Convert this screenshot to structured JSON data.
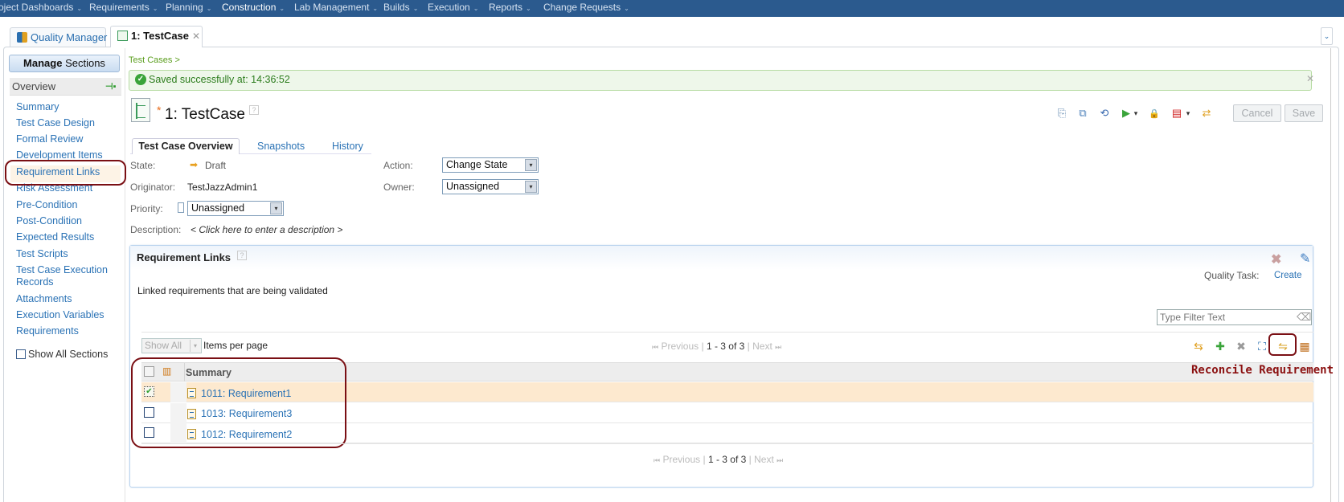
{
  "topnav": {
    "items": [
      {
        "label": "oject Dashboards"
      },
      {
        "label": "Requirements"
      },
      {
        "label": "Planning"
      },
      {
        "label": "Construction"
      },
      {
        "label": "Lab Management"
      },
      {
        "label": "Builds"
      },
      {
        "label": "Execution"
      },
      {
        "label": "Reports"
      },
      {
        "label": "Change Requests"
      }
    ],
    "active": "Construction",
    "chevron": "⌄"
  },
  "tabs": {
    "items": [
      {
        "label": "Quality Manager"
      },
      {
        "label": "1: TestCase",
        "close": "✕"
      }
    ],
    "dropdown": "⌄"
  },
  "sidebar": {
    "manage_bold": "Manage",
    "manage_rest": " Sections",
    "overview": "Overview",
    "pin": "⊣▪",
    "items": [
      {
        "label": "Summary"
      },
      {
        "label": "Test Case Design"
      },
      {
        "label": "Formal Review"
      },
      {
        "label": "Development Items"
      },
      {
        "label": "Requirement Links"
      },
      {
        "label": "Risk Assessment"
      },
      {
        "label": "Pre-Condition"
      },
      {
        "label": "Post-Condition"
      },
      {
        "label": "Expected Results"
      },
      {
        "label": "Test Scripts"
      },
      {
        "label": "Test Case Execution"
      },
      {
        "label": "Records"
      },
      {
        "label": "Attachments"
      },
      {
        "label": "Execution Variables"
      },
      {
        "label": "Requirements"
      }
    ],
    "active_item": "Requirement Links",
    "show_all_sections": "Show All Sections"
  },
  "main": {
    "breadcrumb": "Test Cases >",
    "saved_message": "Saved successfully at: 14:36:52",
    "saved_check": "✓",
    "saved_close": "✕",
    "dirty_marker": "*",
    "title": "1: TestCase",
    "help": "?",
    "toolbar_icons": [
      {
        "name": "copy-icon",
        "glyph": "⎘",
        "color": "#6a8fb5"
      },
      {
        "name": "duplicate-icon",
        "glyph": "⧉",
        "color": "#4a7fb8"
      },
      {
        "name": "sync-icon",
        "glyph": "⟲",
        "color": "#3a6ab0"
      },
      {
        "name": "run-icon",
        "glyph": "▶",
        "color": "#3aa43a"
      },
      {
        "name": "run-dropdown-icon",
        "glyph": "▾",
        "color": "#333"
      },
      {
        "name": "lock-icon",
        "glyph": "🔒",
        "color": "#d8a020"
      },
      {
        "name": "pdf-icon",
        "glyph": "▤",
        "color": "#d02020"
      },
      {
        "name": "pdf-dropdown-icon",
        "glyph": "▾",
        "color": "#333"
      },
      {
        "name": "refresh-icon",
        "glyph": "⇄",
        "color": "#e0a020"
      }
    ],
    "cancel_label": "Cancel",
    "save_label": "Save",
    "section_tabs": [
      {
        "label": "Test Case Overview"
      },
      {
        "label": "Snapshots"
      },
      {
        "label": "History"
      }
    ],
    "fields": {
      "state_label": "State:",
      "state_value": "Draft",
      "state_icon": "➡",
      "originator_label": "Originator:",
      "originator_value": "TestJazzAdmin1",
      "priority_label": "Priority:",
      "priority_value": "Unassigned",
      "description_label": "Description:",
      "description_value": "< Click here to enter a description >",
      "action_label": "Action:",
      "action_value": "Change State",
      "owner_label": "Owner:",
      "owner_value": "Unassigned",
      "select_arrow": "▾"
    }
  },
  "requirement_links": {
    "title": "Requirement Links",
    "help": "?",
    "close_glyph": "✖",
    "edit_glyph": "✎",
    "quality_task_label": "Quality Task:",
    "quality_task_create": "Create",
    "description": "Linked requirements that are being validated",
    "filter_placeholder": "Type Filter Text",
    "filter_clear_glyph": "⌫",
    "items_per_page_value": "Show All",
    "items_per_page_label": "Items per page",
    "pager": {
      "first": "⏮",
      "previous": "Previous",
      "count": "1 - 3 of 3",
      "next": "Next",
      "last": "⏭",
      "sep": "|"
    },
    "toolbar_icons": [
      {
        "name": "refresh-icon",
        "glyph": "⇆",
        "color": "#e0a020"
      },
      {
        "name": "add-icon",
        "glyph": "✚",
        "color": "#3aa43a"
      },
      {
        "name": "remove-icon",
        "glyph": "✖",
        "color": "#999"
      },
      {
        "name": "link-icon",
        "glyph": "⛶",
        "color": "#2a6fb0"
      },
      {
        "name": "reconcile-requirements-icon",
        "glyph": "⇋",
        "color": "#d8a020"
      },
      {
        "name": "column-config-icon",
        "glyph": "▦",
        "color": "#c07020"
      }
    ],
    "table": {
      "columns_icon": "▥",
      "header_summary": "Summary",
      "rows": [
        {
          "id": "1011",
          "label": "1011: Requirement1",
          "checked": true
        },
        {
          "id": "1013",
          "label": "1013: Requirement3",
          "checked": false
        },
        {
          "id": "1012",
          "label": "1012: Requirement2",
          "checked": false
        }
      ],
      "check_glyph": "✔"
    },
    "annotation": "Reconcile Requirement"
  }
}
